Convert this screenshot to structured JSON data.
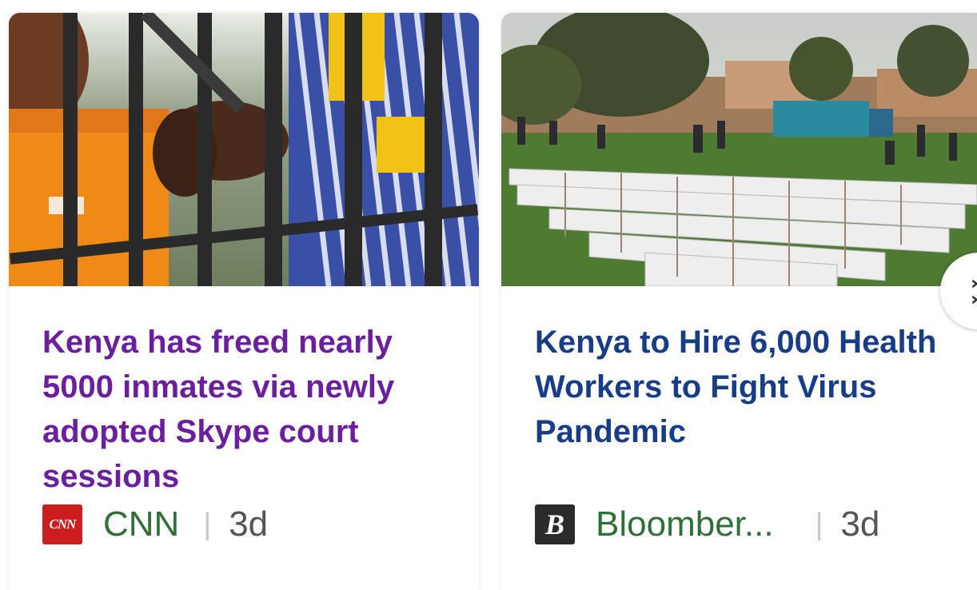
{
  "cards": [
    {
      "headline": "Kenya has freed nearly 5000 inmates via newly adopted Skype court sessions",
      "source": "CNN",
      "source_logo_text": "CNN",
      "age": "3d",
      "image_icon": "prison-bars-photo",
      "headline_color": "#6b1f9e"
    },
    {
      "headline": "Kenya to Hire 6,000 Health Workers to Fight Virus Pandemic",
      "source": "Bloomber...",
      "source_logo_text": "B",
      "age": "3d",
      "image_icon": "field-boxes-photo",
      "headline_color": "#173d88"
    }
  ],
  "separator": "|",
  "next_button_icon": "chevron-right-icon",
  "colors": {
    "source_name": "#2f6f38",
    "age": "#555555"
  }
}
